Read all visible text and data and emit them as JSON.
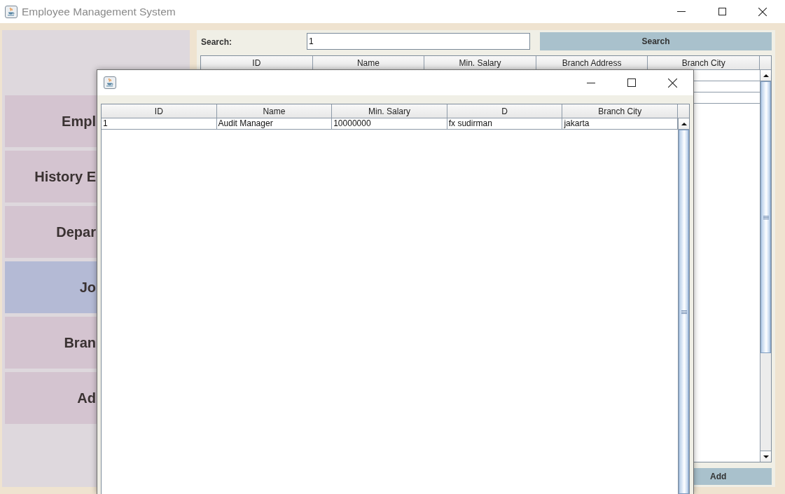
{
  "window": {
    "title": "Employee Management System"
  },
  "sidebar": {
    "items": [
      {
        "label": "Empl",
        "selected": false
      },
      {
        "label": "History E",
        "selected": false
      },
      {
        "label": "Depar",
        "selected": false
      },
      {
        "label": "Jo",
        "selected": true
      },
      {
        "label": "Bran",
        "selected": false
      },
      {
        "label": "Ad",
        "selected": false
      }
    ]
  },
  "search": {
    "label": "Search:",
    "value": "1",
    "button": "Search"
  },
  "table": {
    "columns": [
      "ID",
      "Name",
      "Min. Salary",
      "Branch Address",
      "Branch City"
    ],
    "rows": [
      {
        "selected": false
      },
      {
        "selected": false
      },
      {
        "selected": false
      }
    ]
  },
  "add_button": "Add",
  "dialog": {
    "table": {
      "columns": [
        "ID",
        "Name",
        "Min. Salary",
        "D",
        "Branch City"
      ],
      "rows": [
        {
          "selected": false,
          "cells": [
            "1",
            "Audit Manager",
            "10000000",
            "fx sudirman",
            "jakarta"
          ]
        }
      ]
    }
  }
}
